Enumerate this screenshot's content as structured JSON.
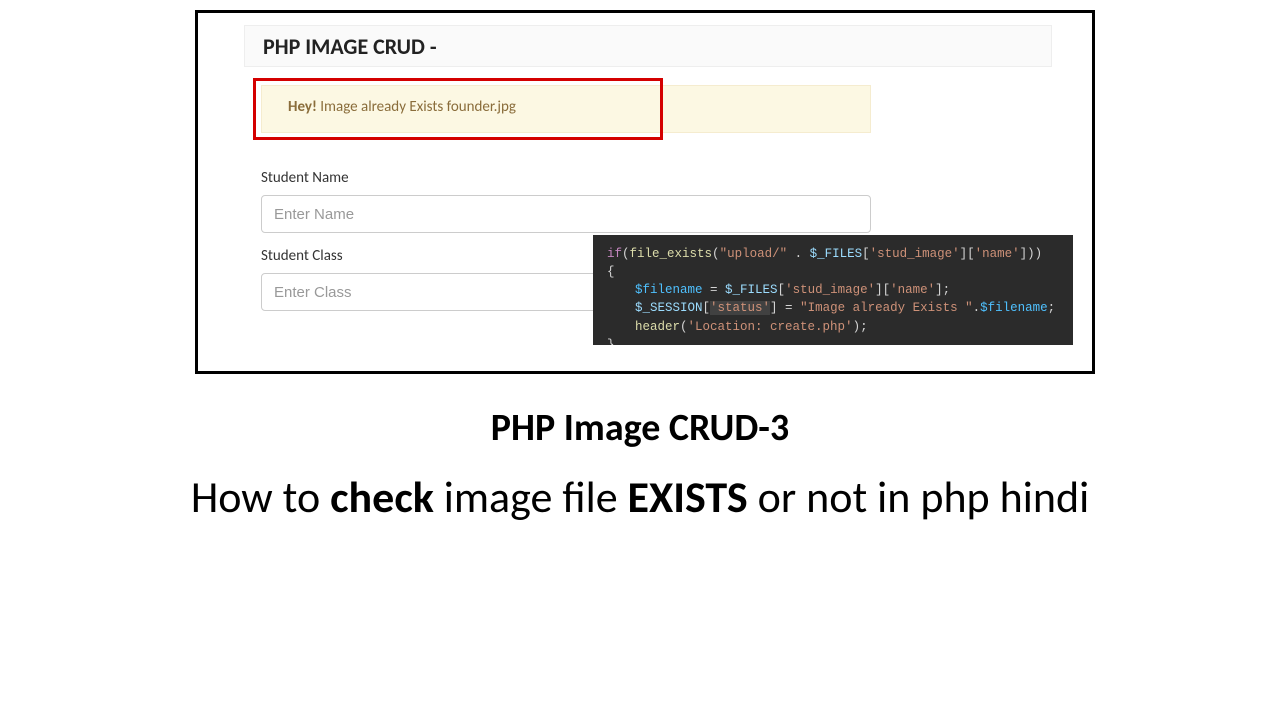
{
  "header": {
    "title": "PHP IMAGE CRUD - "
  },
  "alert": {
    "prefix": "Hey!",
    "message": " Image already Exists founder.jpg"
  },
  "form": {
    "name_label": "Student Name",
    "name_placeholder": "Enter Name",
    "class_label": "Student Class",
    "class_placeholder": "Enter Class"
  },
  "code": {
    "l1_if": "if",
    "l1_fn": "file_exists",
    "l1_p1": "(",
    "l1_s1": "\"upload/\"",
    "l1_dot": " . ",
    "l1_files": "$_FILES",
    "l1_b1": "[",
    "l1_s2": "'stud_image'",
    "l1_b2": "][",
    "l1_s3": "'name'",
    "l1_b3": "]))",
    "l2": "{",
    "l3_var": "$filename",
    "l3_eq": " = ",
    "l3_files": "$_FILES",
    "l3_b1": "[",
    "l3_s1": "'stud_image'",
    "l3_b2": "][",
    "l3_s2": "'name'",
    "l3_b3": "];",
    "l4_sess": "$_SESSION",
    "l4_b1": "[",
    "l4_s1": "'status'",
    "l4_b2": "] = ",
    "l4_s2": "\"Image already Exists \"",
    "l4_dot": ".",
    "l4_var": "$filename",
    "l4_end": ";",
    "l5_fn": "header",
    "l5_p1": "(",
    "l5_s1": "'Location: create.php'",
    "l5_p2": ");",
    "l6": "}"
  },
  "caption": {
    "title": "PHP Image CRUD-3",
    "sub_pre": "How to ",
    "sub_b1": "check",
    "sub_mid": " image file ",
    "sub_b2": "EXISTS",
    "sub_post": " or not in php hindi"
  }
}
